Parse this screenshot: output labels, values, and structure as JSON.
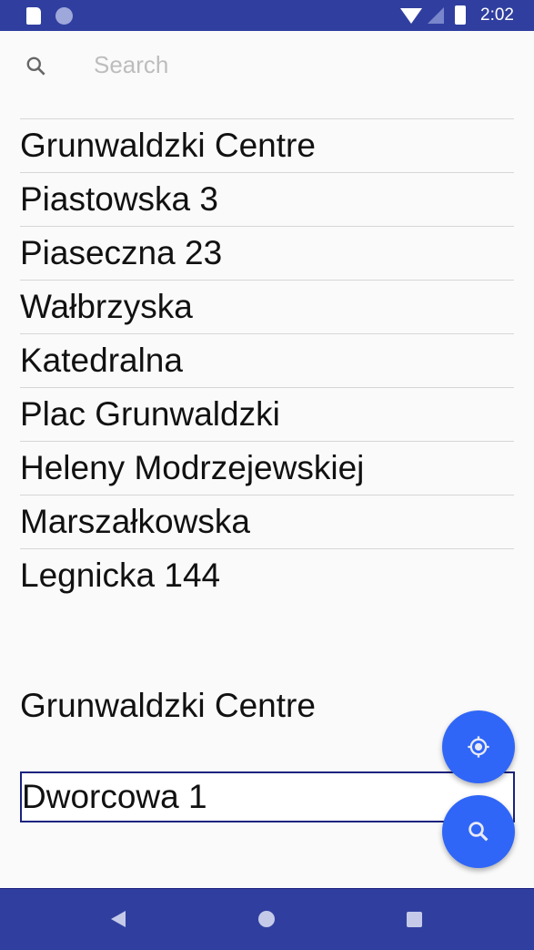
{
  "status_bar": {
    "time": "2:02",
    "icons": [
      "sd-card-icon",
      "sync-icon",
      "wifi-icon",
      "signal-icon",
      "battery-charging-icon"
    ]
  },
  "search": {
    "placeholder": "Search",
    "value": ""
  },
  "list": {
    "items": [
      "Dworcowa 1",
      "Grunwaldzki Centre",
      "Piastowska 3",
      "Piaseczna 23",
      "Wałbrzyska",
      "Katedralna",
      "Plac Grunwaldzki",
      "Heleny Modrzejewskiej",
      "Marszałkowska",
      "Legnicka 144"
    ]
  },
  "selected_text": "Grunwaldzki Centre",
  "input": {
    "value": "Dworcowa 1"
  },
  "fabs": {
    "location_icon": "my-location-icon",
    "search_icon": "search-icon"
  },
  "colors": {
    "primary": "#303f9f",
    "accent": "#2f66f7"
  }
}
